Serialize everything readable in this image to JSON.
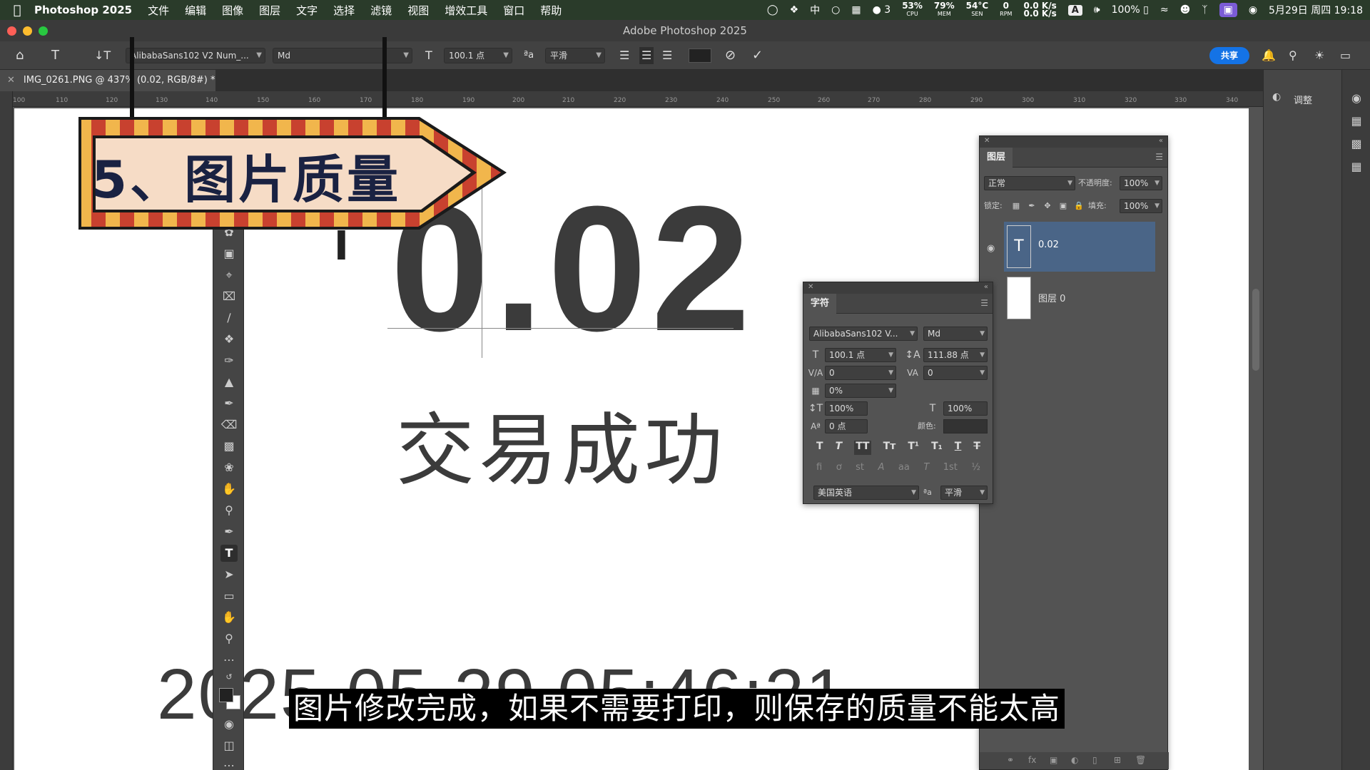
{
  "menubar": {
    "app_name": "Photoshop 2025",
    "menus": [
      "文件",
      "编辑",
      "图像",
      "图层",
      "文字",
      "选择",
      "滤镜",
      "视图",
      "增效工具",
      "窗口",
      "帮助"
    ],
    "wechat_count": "3",
    "cpu": "53%",
    "cpu_label": "CPU",
    "mem": "79%",
    "mem_label": "MEM",
    "sen": "54°C",
    "sen_label": "SEN",
    "rpm": "0",
    "rpm_label": "RPM",
    "net_up": "0.0 K/s",
    "net_down": "0.0 K/s",
    "input_method": "A",
    "battery": "100%",
    "datetime": "5月29日 周四 19:18"
  },
  "window": {
    "title": "Adobe Photoshop 2025"
  },
  "options_bar": {
    "font_family": "AlibabaSans102 V2 Num_...",
    "font_style": "Md",
    "font_size": "100.1 点",
    "aa_label": "ªa",
    "anti_alias": "平滑",
    "share_label": "共享"
  },
  "document": {
    "tab_title": "IMG_0261.PNG @ 437% (0.02, RGB/8#) *",
    "ruler_marks": [
      "100",
      "110",
      "120",
      "130",
      "140",
      "150",
      "160",
      "170",
      "180",
      "190",
      "200",
      "210",
      "220",
      "230",
      "240",
      "250",
      "260",
      "270",
      "280",
      "290",
      "300",
      "310",
      "320",
      "330",
      "340"
    ]
  },
  "canvas": {
    "main_number": "0.02",
    "status_text": "交易成功",
    "datetime_text": "2025-05-29 05:46:21"
  },
  "banner": {
    "text": "5、图片质量"
  },
  "panels": {
    "adjust_label": "调整",
    "layers": {
      "tab": "图层",
      "blend_mode": "正常",
      "opacity_label": "不透明度:",
      "opacity": "100%",
      "lock_label": "锁定:",
      "fill_label": "填充:",
      "fill": "100%",
      "items": [
        {
          "name": "0.02",
          "type": "text",
          "selected": true
        },
        {
          "name": "图层 0",
          "type": "image",
          "selected": false
        }
      ]
    },
    "character": {
      "tab": "字符",
      "font_family": "AlibabaSans102 V...",
      "font_style": "Md",
      "font_size": "100.1 点",
      "leading": "111.88 点",
      "kerning": "0",
      "tracking": "0",
      "tsume": "0%",
      "vertical_scale": "100%",
      "horizontal_scale": "100%",
      "baseline_shift": "0 点",
      "color_label": "颜色:",
      "language": "美国英语",
      "aa_label": "ªa",
      "anti_alias": "平滑"
    }
  },
  "subtitle": {
    "text": "图片修改完成，如果不需要打印，则保存的质量不能太高"
  },
  "colors": {
    "accent": "#1473e6",
    "banner_red": "#c8412f",
    "banner_yellow": "#f1b64c",
    "banner_cream": "#f6dcc6",
    "selected_layer": "#4a6587"
  }
}
